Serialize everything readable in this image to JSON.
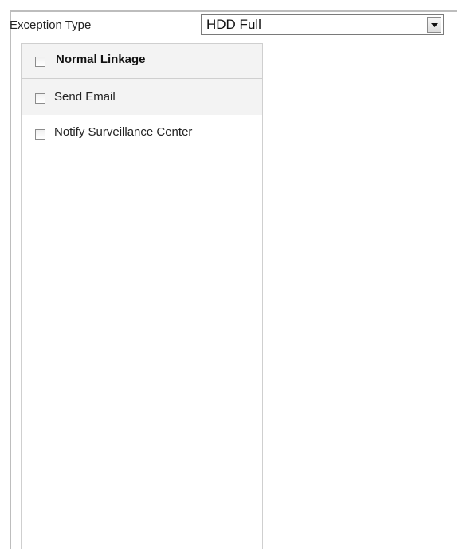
{
  "exception_type": {
    "label": "Exception Type",
    "selected_value": "HDD Full",
    "dropdown_icon": "chevron-down-icon"
  },
  "linkage": {
    "header_label": "Normal Linkage",
    "header_checked": false,
    "items": [
      {
        "label": "Send Email",
        "checked": false
      },
      {
        "label": "Notify Surveillance Center",
        "checked": false
      }
    ]
  }
}
